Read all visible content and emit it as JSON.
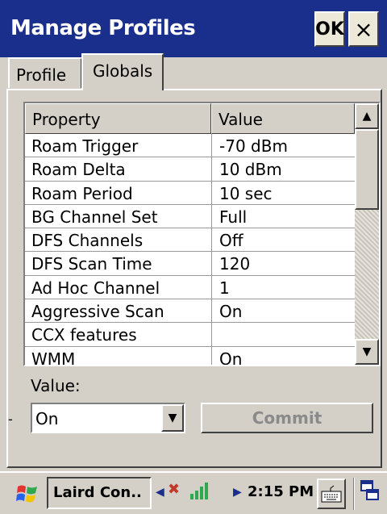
{
  "window": {
    "title": "Manage Profiles",
    "ok_label": "OK",
    "close_label": "×"
  },
  "tabs": [
    {
      "label": "Profile",
      "selected": false
    },
    {
      "label": "Globals",
      "selected": true
    }
  ],
  "table": {
    "headers": [
      "Property",
      "Value"
    ],
    "rows": [
      {
        "property": "Roam Trigger",
        "value": "-70 dBm"
      },
      {
        "property": "Roam Delta",
        "value": "10 dBm"
      },
      {
        "property": "Roam Period",
        "value": "10 sec"
      },
      {
        "property": "BG Channel Set",
        "value": "Full"
      },
      {
        "property": "DFS Channels",
        "value": "Off"
      },
      {
        "property": "DFS Scan Time",
        "value": "120"
      },
      {
        "property": "Ad Hoc Channel",
        "value": "1"
      },
      {
        "property": "Aggressive Scan",
        "value": "On"
      },
      {
        "property": "CCX features",
        "value": ""
      },
      {
        "property": "WMM",
        "value": "On"
      }
    ]
  },
  "scrollbar": {
    "up_icon": "▲",
    "down_icon": "▼"
  },
  "value_editor": {
    "label": "Value:",
    "dash": "-",
    "selected": "On",
    "dropdown_icon": "▼",
    "commit_label": "Commit"
  },
  "taskbar": {
    "start_icon": "windows-flag-icon",
    "task_label": "Laird Con..",
    "left_arrow": "◀",
    "right_arrow": "▶",
    "clock": "2:15 PM",
    "keyboard_icon": "keyboard-icon",
    "switcher_icon": "window-switcher-icon"
  },
  "colors": {
    "title_bar": "#1a2f8c",
    "face": "#d4d0c8",
    "disabled_text": "#8a8a8a"
  }
}
